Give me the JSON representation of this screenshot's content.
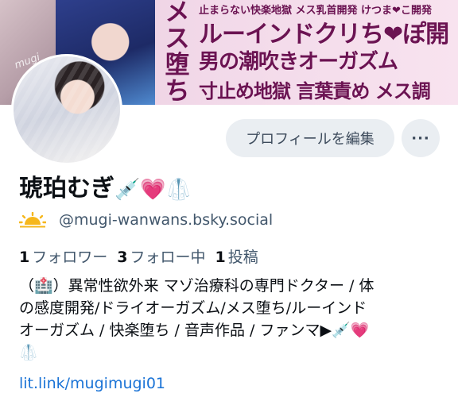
{
  "banner": {
    "vertical_text": [
      "メ",
      "ス",
      "堕",
      "ち"
    ],
    "line0": "止まらない快楽地獄 メス乳首開発 けつま❤こ開発",
    "line1": "ルーインドクリち❤ぽ開",
    "line2": "男の潮吹きオーガズム",
    "line3": "寸止め地獄 言葉責め メス調"
  },
  "profile": {
    "edit_button": "プロフィールを編集",
    "more_button": "···",
    "name": "琥珀むぎ",
    "name_emojis": [
      "💉",
      "💗",
      "🥼"
    ],
    "handle_icon": "sunrise-icon",
    "handle": "@mugi-wanwans.bsky.social",
    "followers_count": "1",
    "followers_label": "フォロワー",
    "following_count": "3",
    "following_label": "フォロー中",
    "posts_count": "1",
    "posts_label": "投稿",
    "bio_lines": [
      "（🏥）異常性欲外来 マゾ治療科の専門ドクター / 体",
      "の感度開発/ドライオーガズム/メス堕ち/ルーインド",
      "オーガズム / 快楽堕ち / 音声作品 / ファンマ▶💉💗",
      "🥼"
    ],
    "link": "lit.link/mugimugi01"
  },
  "colors": {
    "accent_link": "#1a73d6",
    "banner_text": "#6b1352",
    "button_bg": "#eaeef2"
  }
}
